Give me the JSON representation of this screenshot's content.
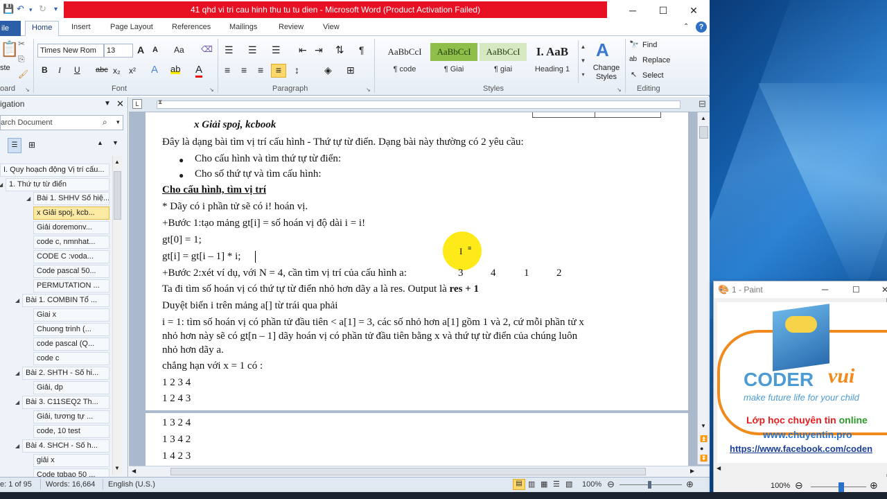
{
  "window": {
    "title": "41 qhd vi tri cau hinh thu tu tu dien - Microsoft Word (Product Activation Failed)",
    "minimize": "─",
    "maximize": "☐",
    "close": "✕"
  },
  "tabs": {
    "file": "ile",
    "items": [
      "Home",
      "Insert",
      "Page Layout",
      "References",
      "Mailings",
      "Review",
      "View"
    ]
  },
  "ribbon": {
    "clipboard": {
      "paste": "ste",
      "label": "oard"
    },
    "font": {
      "name": "Times New Rom",
      "size": "13",
      "label": "Font",
      "bold": "B",
      "italic": "I",
      "underline": "U",
      "strike": "abc",
      "sub": "x₂",
      "sup": "x²",
      "grow": "A",
      "shrink": "A",
      "case": "Aa"
    },
    "paragraph": {
      "label": "Paragraph",
      "pilcrow": "¶"
    },
    "styles": {
      "label": "Styles",
      "items": [
        {
          "preview": "AaBbCcI",
          "name": "¶ code"
        },
        {
          "preview": "AaBbCcI",
          "name": "¶ Giai"
        },
        {
          "preview": "AaBbCcI",
          "name": "¶ giai"
        },
        {
          "preview": "I.  AaB",
          "name": "Heading 1"
        }
      ],
      "change_styles": "Change Styles"
    },
    "editing": {
      "label": "Editing",
      "find": "Find",
      "replace": "Replace",
      "select": "Select"
    }
  },
  "nav": {
    "title": "igation",
    "search_placeholder": "arch Document",
    "items": [
      {
        "text": "I. Quy hoạch động Vị trí cấu..."
      },
      {
        "text": "1. Thứ tự từ điển"
      },
      {
        "text": "Bài 1. SHHV Số hiệ..."
      },
      {
        "text": "x Giải spoj, kcb..."
      },
      {
        "text": "Giải doremonv..."
      },
      {
        "text": "code c, nmnhat..."
      },
      {
        "text": "CODE C  :voda..."
      },
      {
        "text": "Code pascal 50..."
      },
      {
        "text": "PERMUTATION ..."
      },
      {
        "text": "Bài 1. COMBIN Tổ ..."
      },
      {
        "text": "Giai x"
      },
      {
        "text": "Chuong trinh (..."
      },
      {
        "text": "code pascal (Q..."
      },
      {
        "text": "code c"
      },
      {
        "text": "Bài 2. SHTH - Số hi..."
      },
      {
        "text": "Giải, dp"
      },
      {
        "text": "Bài 3. C11SEQ2 Th..."
      },
      {
        "text": "Giải, tương tự ..."
      },
      {
        "text": "code, 10 test"
      },
      {
        "text": "Bài 4. SHCH - Số h..."
      },
      {
        "text": "giải x"
      },
      {
        "text": "Code tqbao 50 ..."
      }
    ]
  },
  "document": {
    "heading": "x Giải spoj, kcbook",
    "p1": "Đây là dạng bài tìm vị trí cấu hình - Thứ tự từ điển. Dạng bài này thường có 2 yêu cầu:",
    "b1": "Cho cấu hình và tìm thứ tự từ điển:",
    "b2": "Cho số thứ tự và tìm cấu hình:",
    "section": "Cho cấu hình, tìm vị trí",
    "l1": "* Dãy có i phần tử sẽ có i! hoán vị.",
    "l2": "+Bước 1:tạo mảng gt[i] = số hoán vị độ dài i = i!",
    "l3": "gt[0] = 1;",
    "l4": "gt[i] = gt[i – 1] * i;",
    "l5": "+Bước 2:xét ví dụ, với N = 4, cần tìm vị trí của cấu hình a:",
    "l5_values": [
      "3",
      "4",
      "1",
      "2"
    ],
    "l6a": "Ta đi tìm số hoán vị có thứ tự từ điển nhỏ hơn dãy a là res. Output là ",
    "l6b": "res + 1",
    "l7": "Duyệt biến i trên mảng a[] từ trái qua phải",
    "l8": "i = 1: tìm số hoán vị có phần tử đầu tiên < a[1] = 3, các số nhỏ hơn a[1] gồm 1 và 2, cứ mỗi phần tử x",
    "l9": "nhỏ hơn này sẽ có gt[n – 1] dãy hoán vị có phần tử đầu tiên bằng x và thứ tự từ điển của chúng luôn",
    "l10": "nhỏ hơn dãy a.",
    "l11": "chẳng hạn với x = 1 có :",
    "l12": "1 2 3 4",
    "l13": "1 2 4 3",
    "l14": "1 3 2 4",
    "l15": "1 3 4 2",
    "l16": "1 4 2 3"
  },
  "status": {
    "page": "e: 1 of 95",
    "words": "Words: 16,664",
    "lang": "English (U.S.)",
    "zoom": "100%"
  },
  "paint": {
    "title": "1 - Paint",
    "brand1": "CODER",
    "brand2": "vui",
    "tagline": "make future life for your child",
    "line1a": "Lớp học chuyên tin ",
    "line1b": "online",
    "line2": "www.chuyentin.pro",
    "line3": "https://www.facebook.com/coden",
    "zoom": "100%"
  }
}
